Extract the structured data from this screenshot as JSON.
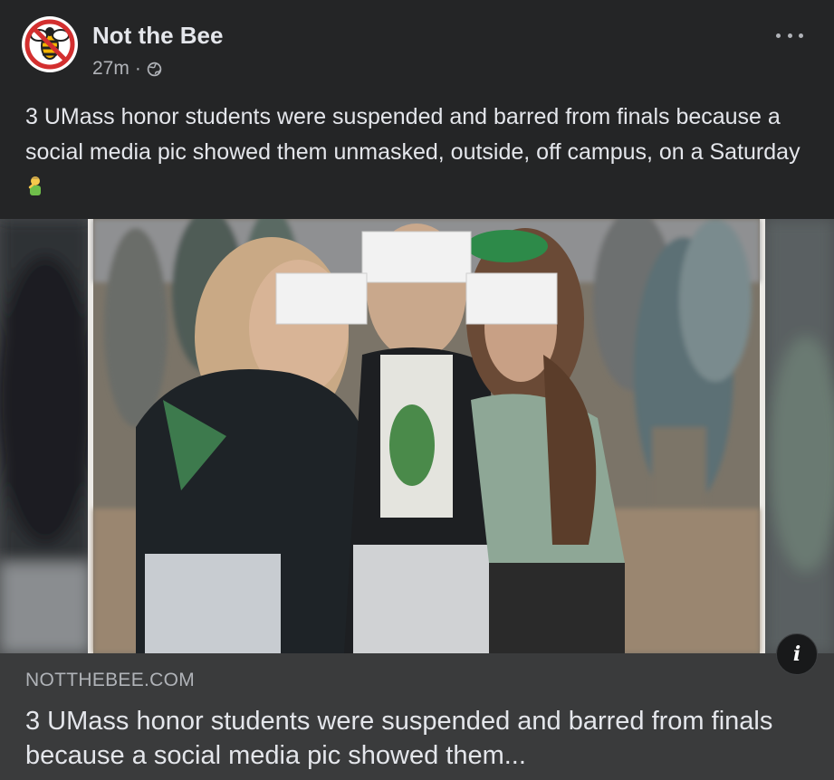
{
  "post": {
    "page_name": "Not the Bee",
    "time": "27m",
    "separator": "·",
    "privacy_icon": "globe-icon",
    "more_icon": "more-horizontal-icon",
    "text": "3 UMass honor students were suspended and barred from finals because a social media pic showed them unmasked, outside, off campus, on a Saturday",
    "emoji_icon": "person-facepalming-emoji"
  },
  "link_preview": {
    "domain": "NOTTHEBEE.COM",
    "title": "3 UMass honor students were suspended and barred from finals because a social media pic showed them..."
  },
  "info_button": {
    "label": "i",
    "icon": "info-icon"
  },
  "colors": {
    "background": "#242526",
    "preview_background": "#3a3b3c",
    "primary_text": "#e4e6eb",
    "secondary_text": "#b0b3b8",
    "logo_red": "#d32f2f"
  }
}
